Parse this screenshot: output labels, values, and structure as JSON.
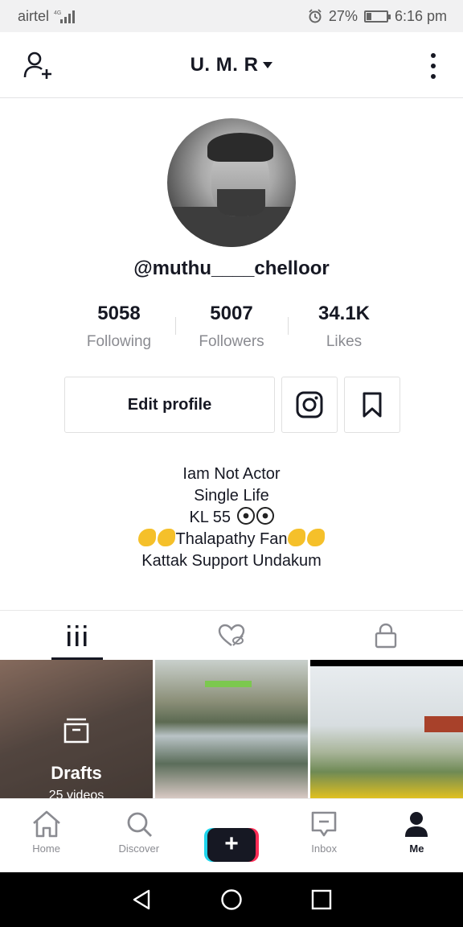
{
  "status_bar": {
    "carrier": "airtel",
    "network": "4G",
    "battery_percent": "27%",
    "battery_level": 0.27,
    "time": "6:16 pm"
  },
  "header": {
    "title": "U. M. R"
  },
  "profile": {
    "username": "@muthu____chelloor",
    "stats": [
      {
        "value": "5058",
        "label": "Following"
      },
      {
        "value": "5007",
        "label": "Followers"
      },
      {
        "value": "34.1K",
        "label": "Likes"
      }
    ],
    "edit_label": "Edit profile",
    "bio": {
      "line1": "Iam Not Actor",
      "line2": "Single Life",
      "line3": "KL 55",
      "line4": "Thalapathy Fan",
      "line5": "Kattak Support Undakum"
    }
  },
  "grid": {
    "drafts_label": "Drafts",
    "drafts_count": "25 videos"
  },
  "bottom_nav": {
    "home": "Home",
    "discover": "Discover",
    "inbox": "Inbox",
    "me": "Me"
  },
  "icons": {
    "add_user": "person-add-icon",
    "menu": "more-vertical-icon",
    "instagram": "instagram-icon",
    "bookmark": "bookmark-icon",
    "videos_tab": "grid-icon",
    "liked_tab": "heart-hidden-icon",
    "private_tab": "lock-icon"
  },
  "colors": {
    "text": "#161823",
    "secondary": "#8a8b91",
    "accent_cyan": "#20d5ec",
    "accent_red": "#fe2c55"
  }
}
